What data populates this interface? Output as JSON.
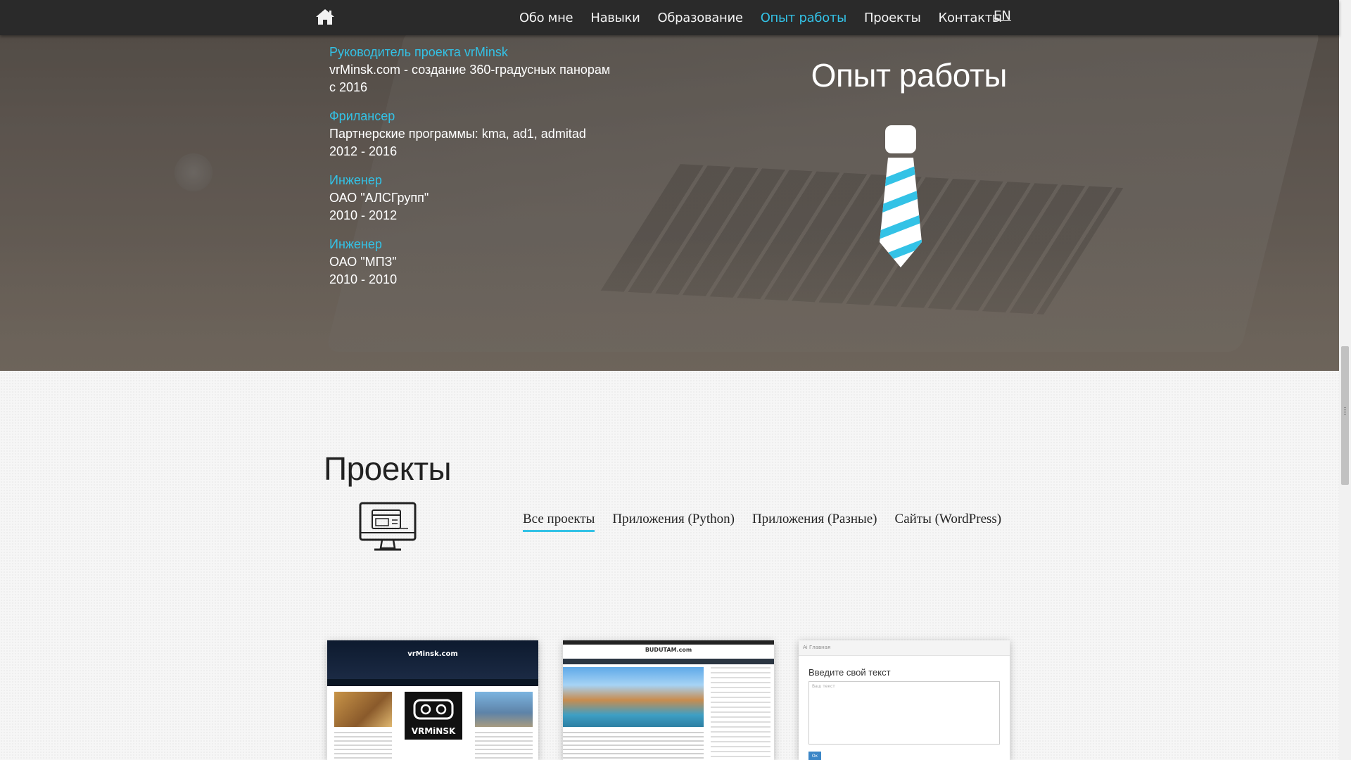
{
  "nav": {
    "items": [
      {
        "label": "Обо мне",
        "active": false
      },
      {
        "label": "Навыки",
        "active": false
      },
      {
        "label": "Образование",
        "active": false
      },
      {
        "label": "Опыт работы",
        "active": true
      },
      {
        "label": "Проекты",
        "active": false
      },
      {
        "label": "Контакты",
        "active": false
      }
    ],
    "lang": "EN",
    "home_icon": "home-icon"
  },
  "experience": {
    "heading": "Опыт работы",
    "icon": "tie-icon",
    "jobs": [
      {
        "title": "Руководитель проекта vrMinsk",
        "company": "vrMinsk.com - создание 360-градусных панорам",
        "period": "с 2016"
      },
      {
        "title": "Фрилансер",
        "company": "Партнерские программы: kma, ad1, admitad",
        "period": "2012 - 2016"
      },
      {
        "title": "Инженер",
        "company": "ОАО \"АЛСГрупп\"",
        "period": "2010 - 2012"
      },
      {
        "title": "Инженер",
        "company": "ОАО \"МПЗ\"",
        "period": "2010 - 2010"
      }
    ]
  },
  "projects": {
    "heading": "Проекты",
    "icon": "monitor-icon",
    "filters": [
      {
        "label": "Все проекты",
        "active": true
      },
      {
        "label": "Приложения (Python)",
        "active": false
      },
      {
        "label": "Приложения (Разные)",
        "active": false
      },
      {
        "label": "Сайты (WordPress)",
        "active": false
      }
    ],
    "cards": [
      {
        "site_title": "vrMinsk.com",
        "badge": "VRMiNSK"
      },
      {
        "site_title": "BUDUTAM.com"
      },
      {
        "tabs": "Ai   Главная",
        "label": "Введите свой текст",
        "placeholder": "Ваш текст",
        "button": "Ок"
      }
    ]
  },
  "colors": {
    "accent": "#33c2e6",
    "navbar": "#2a2a2a",
    "text_light": "#ffffff"
  }
}
